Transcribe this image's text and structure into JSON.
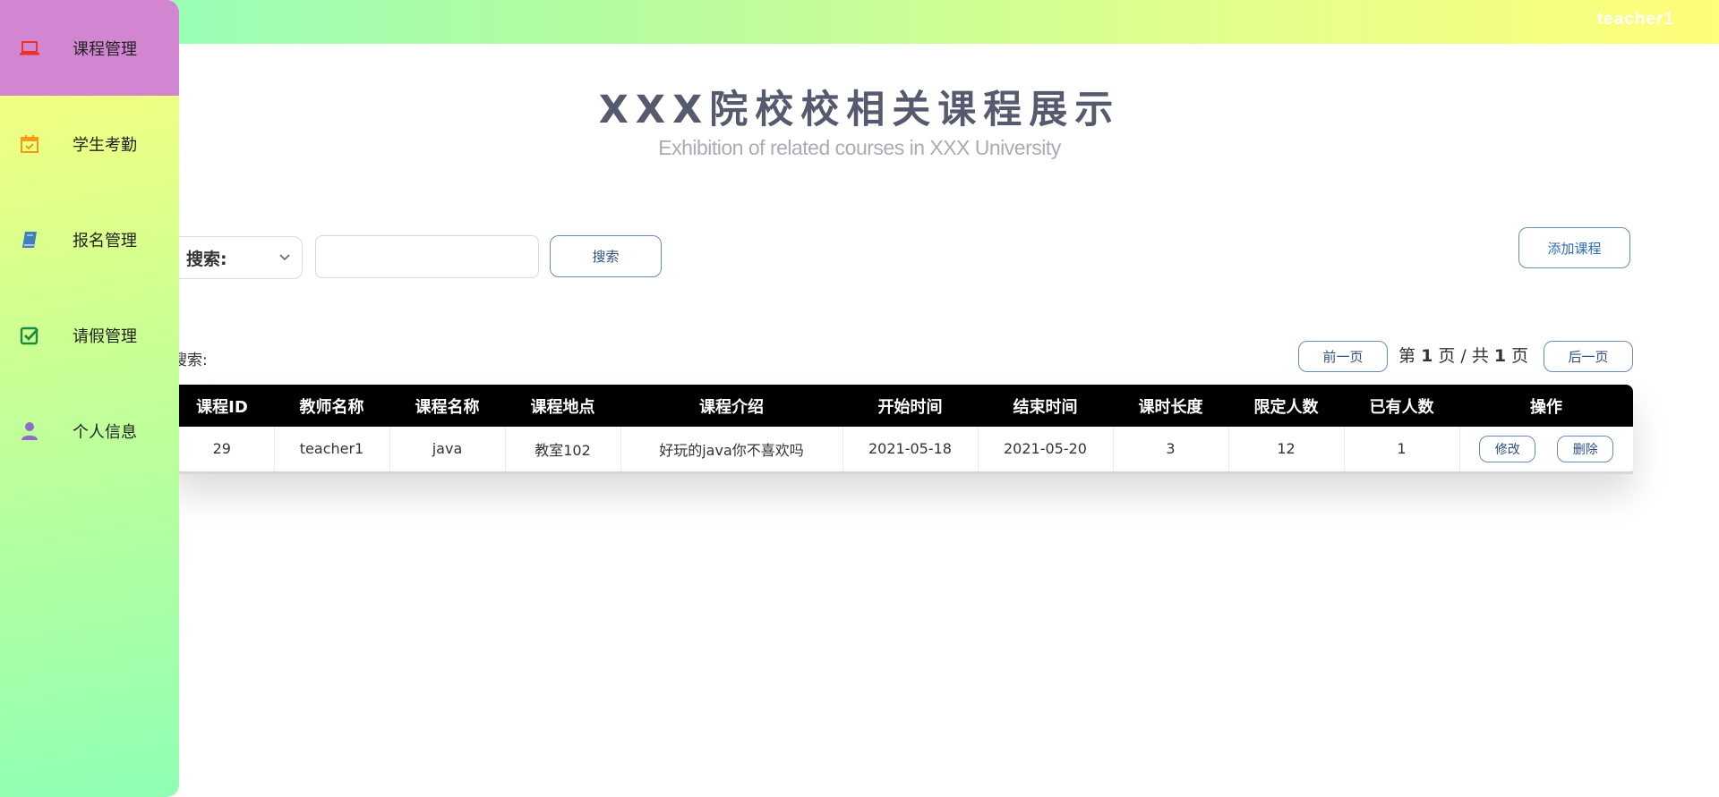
{
  "header": {
    "username": "teacher1"
  },
  "sidebar": {
    "items": [
      {
        "label": "课程管理",
        "icon": "laptop-icon",
        "active": true
      },
      {
        "label": "学生考勤",
        "icon": "calendar-check-icon",
        "active": false
      },
      {
        "label": "报名管理",
        "icon": "book-icon",
        "active": false
      },
      {
        "label": "请假管理",
        "icon": "check-square-icon",
        "active": false
      },
      {
        "label": "个人信息",
        "icon": "user-icon",
        "active": false
      }
    ]
  },
  "main": {
    "title": "XXX院校校相关课程展示",
    "subtitle": "Exhibition of related courses in XXX University",
    "search": {
      "select_label": "搜索:",
      "input_value": "",
      "button_label": "搜索"
    },
    "add_button_label": "添加课程",
    "search_status": "搜索:",
    "pagination": {
      "prev_label": "前一页",
      "next_label": "后一页",
      "prefix": "第",
      "current_page": "1",
      "middle": "页 / 共",
      "total_pages": "1",
      "suffix": "页"
    },
    "table": {
      "headers": [
        "课程ID",
        "教师名称",
        "课程名称",
        "课程地点",
        "课程介绍",
        "开始时间",
        "结束时间",
        "课时长度",
        "限定人数",
        "已有人数",
        "操作"
      ],
      "rows": [
        {
          "id": "29",
          "teacher": "teacher1",
          "course": "java",
          "location": "教室102",
          "intro": "好玩的java你不喜欢吗",
          "start": "2021-05-18",
          "end": "2021-05-20",
          "hours": "3",
          "limit": "12",
          "enrolled": "1",
          "edit_label": "修改",
          "delete_label": "删除"
        }
      ]
    }
  },
  "colors": {
    "sidebar_active": "#d286d2",
    "table_header_bg": "#000000",
    "button_border": "#6c8bb3",
    "title": "#565a6e"
  }
}
